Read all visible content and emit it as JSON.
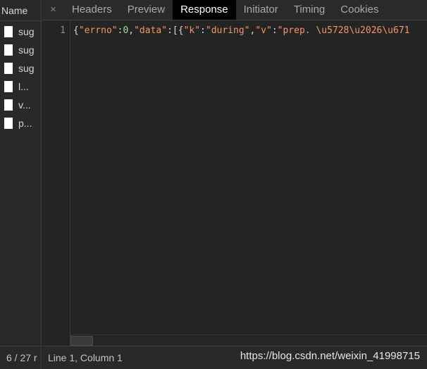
{
  "requests": {
    "header": "Name",
    "items": [
      {
        "label": "sug"
      },
      {
        "label": "sug"
      },
      {
        "label": "sug"
      },
      {
        "label": "l..."
      },
      {
        "label": "v..."
      },
      {
        "label": "p..."
      }
    ],
    "footer": "6 / 27 r"
  },
  "tabs": {
    "close": "×",
    "items": [
      {
        "label": "Headers"
      },
      {
        "label": "Preview"
      },
      {
        "label": "Response"
      },
      {
        "label": "Initiator"
      },
      {
        "label": "Timing"
      },
      {
        "label": "Cookies"
      }
    ],
    "active_index": 2
  },
  "editor": {
    "line_number": "1",
    "tokens": [
      {
        "text": "{",
        "cls": "tok-punc brace-underline"
      },
      {
        "text": "\"errno\"",
        "cls": "tok-key"
      },
      {
        "text": ":",
        "cls": "tok-punc"
      },
      {
        "text": "0",
        "cls": "tok-num"
      },
      {
        "text": ",",
        "cls": "tok-punc"
      },
      {
        "text": "\"data\"",
        "cls": "tok-key"
      },
      {
        "text": ":[{",
        "cls": "tok-punc"
      },
      {
        "text": "\"k\"",
        "cls": "tok-key"
      },
      {
        "text": ":",
        "cls": "tok-punc"
      },
      {
        "text": "\"during\"",
        "cls": "tok-str"
      },
      {
        "text": ",",
        "cls": "tok-punc"
      },
      {
        "text": "\"v\"",
        "cls": "tok-key"
      },
      {
        "text": ":",
        "cls": "tok-punc"
      },
      {
        "text": "\"prep. \\u5728\\u2026\\u671",
        "cls": "tok-str"
      }
    ]
  },
  "status": {
    "position": "Line 1, Column 1",
    "watermark": "https://blog.csdn.net/weixin_41998715"
  },
  "colors": {
    "background": "#242424",
    "active_tab": "#000000",
    "string_token": "#f29766",
    "number_token": "#9fdc9a"
  }
}
